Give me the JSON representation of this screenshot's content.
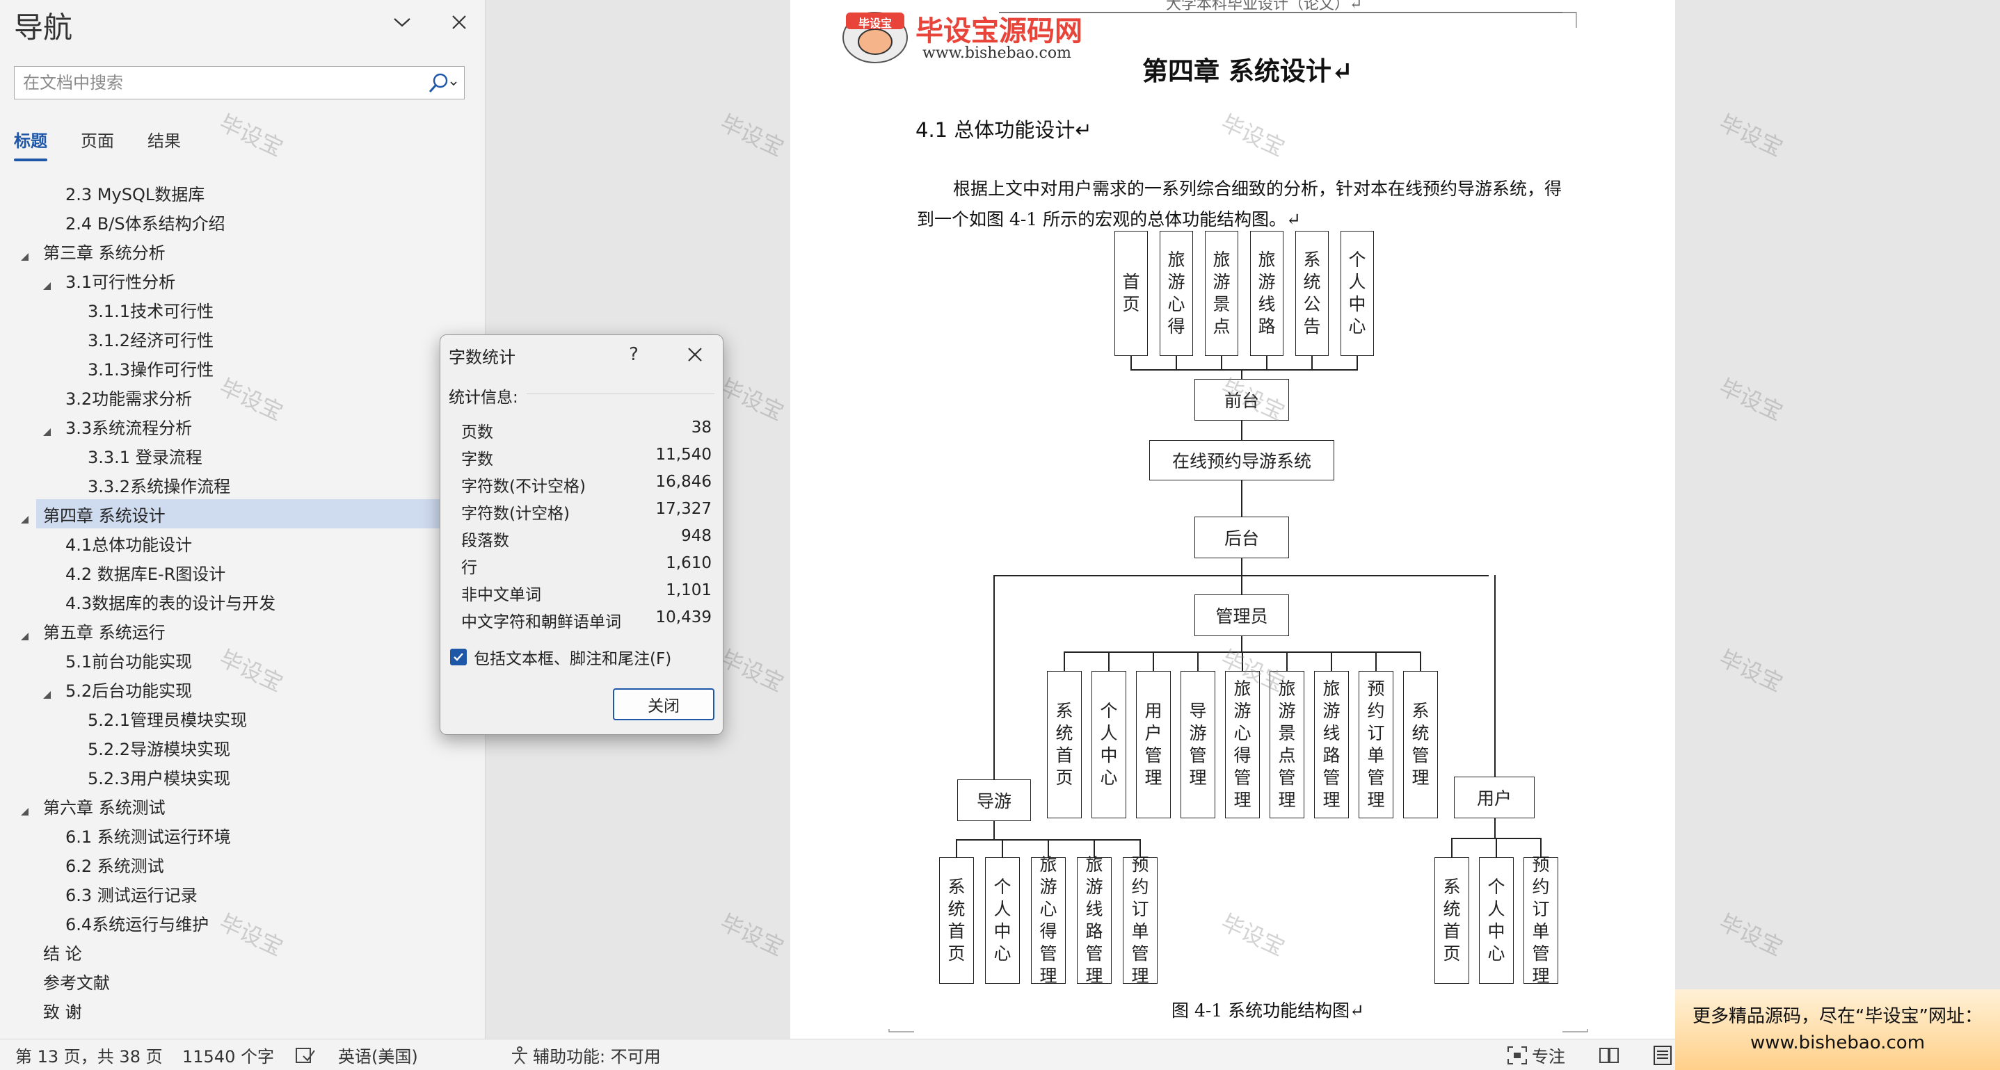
{
  "nav": {
    "title": "导航",
    "search_placeholder": "在文档中搜索",
    "tabs": [
      "标题",
      "页面",
      "结果"
    ],
    "tree": [
      {
        "label": "2.3 MySQL数据库",
        "level": 2,
        "toggle": "none",
        "selected": false
      },
      {
        "label": "2.4 B/S体系结构介绍",
        "level": 2,
        "toggle": "none",
        "selected": false
      },
      {
        "label": "第三章 系统分析",
        "level": 1,
        "toggle": "expanded",
        "selected": false
      },
      {
        "label": "3.1可行性分析",
        "level": 2,
        "toggle": "expanded",
        "selected": false
      },
      {
        "label": "3.1.1技术可行性",
        "level": 3,
        "toggle": "none",
        "selected": false
      },
      {
        "label": "3.1.2经济可行性",
        "level": 3,
        "toggle": "none",
        "selected": false
      },
      {
        "label": "3.1.3操作可行性",
        "level": 3,
        "toggle": "none",
        "selected": false
      },
      {
        "label": "3.2功能需求分析",
        "level": 2,
        "toggle": "none",
        "selected": false
      },
      {
        "label": "3.3系统流程分析",
        "level": 2,
        "toggle": "expanded",
        "selected": false
      },
      {
        "label": "3.3.1 登录流程",
        "level": 3,
        "toggle": "none",
        "selected": false
      },
      {
        "label": "3.3.2系统操作流程",
        "level": 3,
        "toggle": "none",
        "selected": false
      },
      {
        "label": "第四章 系统设计",
        "level": 1,
        "toggle": "expanded",
        "selected": true
      },
      {
        "label": "4.1总体功能设计",
        "level": 2,
        "toggle": "none",
        "selected": false
      },
      {
        "label": "4.2 数据库E-R图设计",
        "level": 2,
        "toggle": "none",
        "selected": false
      },
      {
        "label": "4.3数据库的表的设计与开发",
        "level": 2,
        "toggle": "none",
        "selected": false
      },
      {
        "label": "第五章 系统运行",
        "level": 1,
        "toggle": "expanded",
        "selected": false
      },
      {
        "label": "5.1前台功能实现",
        "level": 2,
        "toggle": "none",
        "selected": false
      },
      {
        "label": "5.2后台功能实现",
        "level": 2,
        "toggle": "expanded",
        "selected": false
      },
      {
        "label": "5.2.1管理员模块实现",
        "level": 3,
        "toggle": "none",
        "selected": false
      },
      {
        "label": "5.2.2导游模块实现",
        "level": 3,
        "toggle": "none",
        "selected": false
      },
      {
        "label": "5.2.3用户模块实现",
        "level": 3,
        "toggle": "none",
        "selected": false
      },
      {
        "label": "第六章 系统测试",
        "level": 1,
        "toggle": "expanded",
        "selected": false
      },
      {
        "label": "6.1 系统测试运行环境",
        "level": 2,
        "toggle": "none",
        "selected": false
      },
      {
        "label": "6.2 系统测试",
        "level": 2,
        "toggle": "none",
        "selected": false
      },
      {
        "label": "6.3 测试运行记录",
        "level": 2,
        "toggle": "none",
        "selected": false
      },
      {
        "label": "6.4系统运行与维护",
        "level": 2,
        "toggle": "none",
        "selected": false
      },
      {
        "label": "结 论",
        "level": 1,
        "toggle": "none",
        "selected": false
      },
      {
        "label": "参考文献",
        "level": 1,
        "toggle": "none",
        "selected": false
      },
      {
        "label": "致 谢",
        "level": 1,
        "toggle": "none",
        "selected": false
      }
    ]
  },
  "document": {
    "header_text": "大学本科毕业设计（论文）↵",
    "logo_badge": "毕设宝",
    "logo_title": "毕设宝源码网",
    "logo_url": "www.bishebao.com",
    "chapter_title": "第四章  系统设计↵",
    "section_title": "4.1 总体功能设计↵",
    "paragraph_line1": "根据上文中对用户需求的一系列综合细致的分析，针对本在线预约导游系统，得",
    "paragraph_line2": "到一个如图 4-1 所示的宏观的总体功能结构图。↵",
    "figure_caption": "图 4-1  系统功能结构图↵",
    "diagram": {
      "front_modules": [
        "首页",
        "旅游心得",
        "旅游景点",
        "旅游线路",
        "系统公告",
        "个人中心"
      ],
      "front": "前台",
      "system": "在线预约导游系统",
      "back": "后台",
      "admin": "管理员",
      "admin_modules": [
        "系统首页",
        "个人中心",
        "用户管理",
        "导游管理",
        "旅游心得管理",
        "旅游景点管理",
        "旅游线路管理",
        "预约订单管理",
        "系统管理"
      ],
      "guide": "导游",
      "guide_modules": [
        "系统首页",
        "个人中心",
        "旅游心得管理",
        "旅游线路管理",
        "预约订单管理"
      ],
      "user": "用户",
      "user_modules": [
        "系统首页",
        "个人中心",
        "预约订单管理"
      ]
    }
  },
  "watermark": "毕设宝",
  "promo": {
    "line1": "更多精品源码，尽在“毕设宝”网址：",
    "line2": "www.bishebao.com"
  },
  "status": {
    "page": "第 13 页，共 38 页",
    "words": "11540 个字",
    "language": "英语(美国)",
    "accessibility": "辅助功能: 不可用",
    "focus": "专注"
  },
  "dialog": {
    "title": "字数统计",
    "help": "?",
    "section": "统计信息:",
    "rows": [
      {
        "label": "页数",
        "value": "38"
      },
      {
        "label": "字数",
        "value": "11,540"
      },
      {
        "label": "字符数(不计空格)",
        "value": "16,846"
      },
      {
        "label": "字符数(计空格)",
        "value": "17,327"
      },
      {
        "label": "段落数",
        "value": "948"
      },
      {
        "label": "行",
        "value": "1,610"
      },
      {
        "label": "非中文单词",
        "value": "1,101"
      },
      {
        "label": "中文字符和朝鲜语单词",
        "value": "10,439"
      }
    ],
    "checkbox_label": "包括文本框、脚注和尾注(F)",
    "checkbox_checked": true,
    "close_label": "关闭"
  }
}
